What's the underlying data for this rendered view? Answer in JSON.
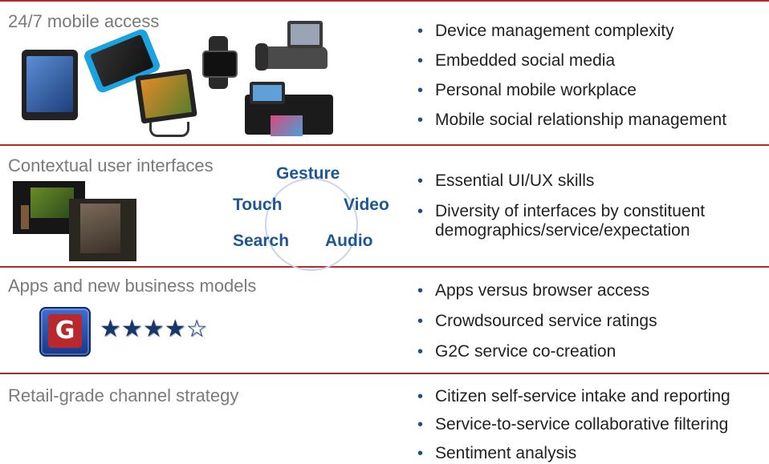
{
  "sections": [
    {
      "title": "24/7 mobile access",
      "bullets": [
        "Device management complexity",
        "Embedded social media",
        "Personal mobile workplace",
        "Mobile social relationship management"
      ]
    },
    {
      "title": "Contextual user interfaces",
      "modes": [
        "Gesture",
        "Touch",
        "Video",
        "Search",
        "Audio"
      ],
      "bullets": [
        "Essential UI/UX skills",
        "Diversity of interfaces by constituent",
        "demographics/service/expectation"
      ]
    },
    {
      "title": "Apps and new business models",
      "app_letter": "G",
      "rating_stars": 4,
      "rating_max": 5,
      "bullets": [
        "Apps versus browser access",
        "Crowdsourced service ratings",
        "G2C service co-creation"
      ]
    },
    {
      "title": "Retail-grade channel strategy",
      "bullets": [
        "Citizen self-service intake and reporting",
        "Service-to-service collaborative filtering",
        "Sentiment analysis"
      ]
    }
  ],
  "bullet_glyph": "•",
  "colors": {
    "rule": "#b8282d",
    "accent": "#1e5594",
    "title": "#7a7a7a"
  }
}
